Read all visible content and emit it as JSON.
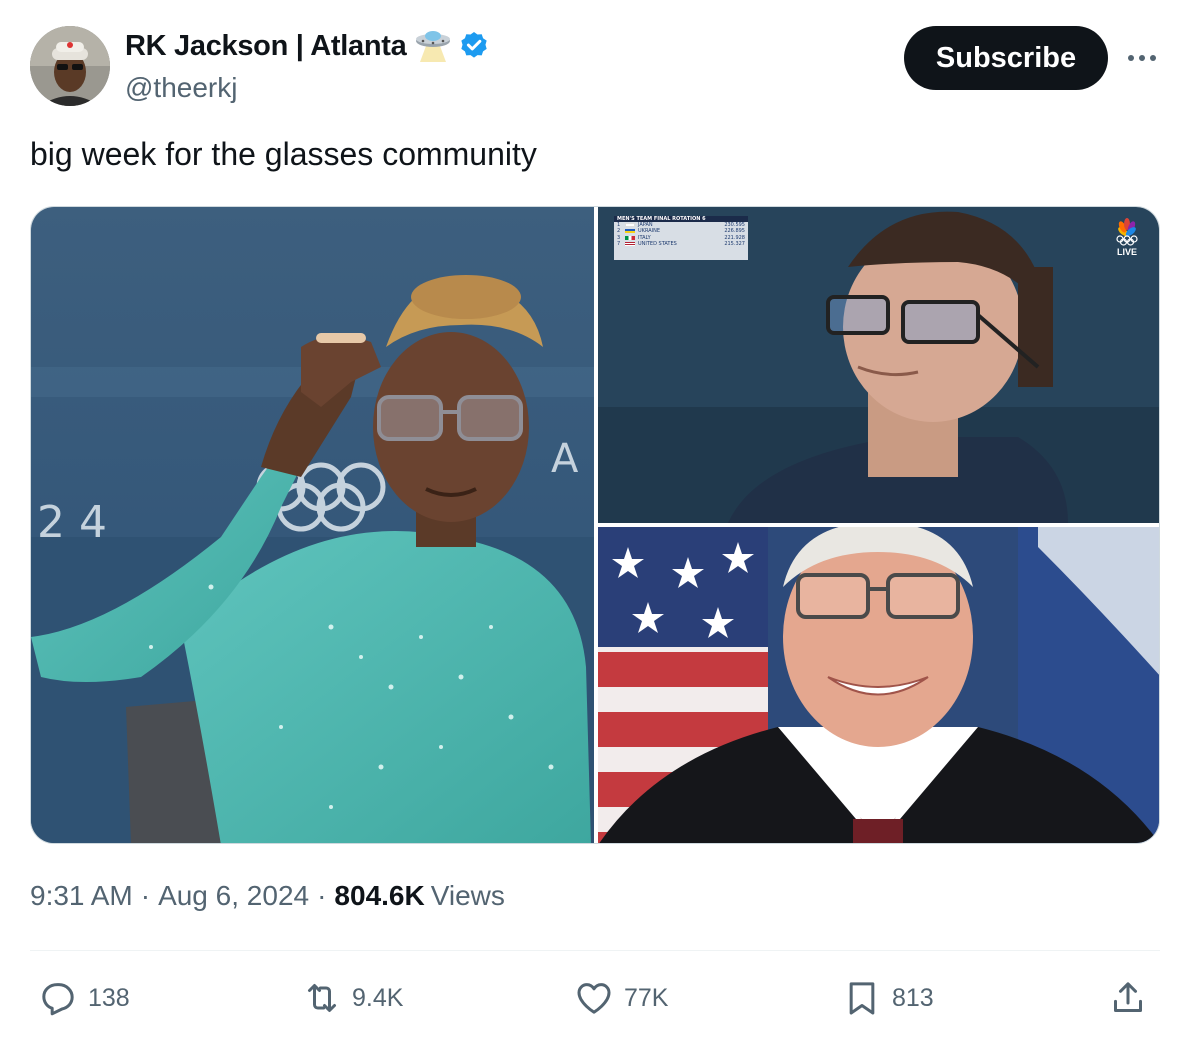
{
  "author": {
    "display_name": "RK Jackson | Atlanta",
    "handle": "@theerkj",
    "avatar_icon": "profile-photo",
    "badges": [
      "ufo-emoji-icon",
      "verified-badge-icon"
    ],
    "verified_color": "#1d9bf0"
  },
  "actions_top": {
    "subscribe_label": "Subscribe",
    "more_icon": "more-horizontal-icon"
  },
  "tweet": {
    "text": "big week for the glasses community"
  },
  "media": {
    "photos": [
      {
        "id": "photo-gymnast-glasses",
        "description_icon": "photo"
      },
      {
        "id": "photo-gymnast-broadcast",
        "description_icon": "photo"
      },
      {
        "id": "photo-politician-portrait",
        "description_icon": "photo"
      }
    ],
    "scoreboard": {
      "title": "MEN'S TEAM FINAL   ROTATION 6",
      "rows": [
        {
          "rank": "1",
          "country": "JAPAN",
          "score": "230.595"
        },
        {
          "rank": "2",
          "country": "UKRAINE",
          "score": "226.895"
        },
        {
          "rank": "3",
          "country": "ITALY",
          "score": "221.928"
        },
        {
          "rank": "7",
          "country": "UNITED STATES",
          "score": "215.327"
        }
      ]
    },
    "live_label": "LIVE",
    "venue_text_left": "2 4",
    "venue_text_right": "A"
  },
  "meta": {
    "time": "9:31 AM",
    "date": "Aug 6, 2024",
    "views_count": "804.6K",
    "views_label": "Views"
  },
  "engagement": {
    "replies": "138",
    "reposts": "9.4K",
    "likes": "77K",
    "bookmarks": "813"
  },
  "colors": {
    "text_primary": "#0f1419",
    "text_secondary": "#536471",
    "button_dark": "#0f1419",
    "accent": "#1d9bf0"
  }
}
